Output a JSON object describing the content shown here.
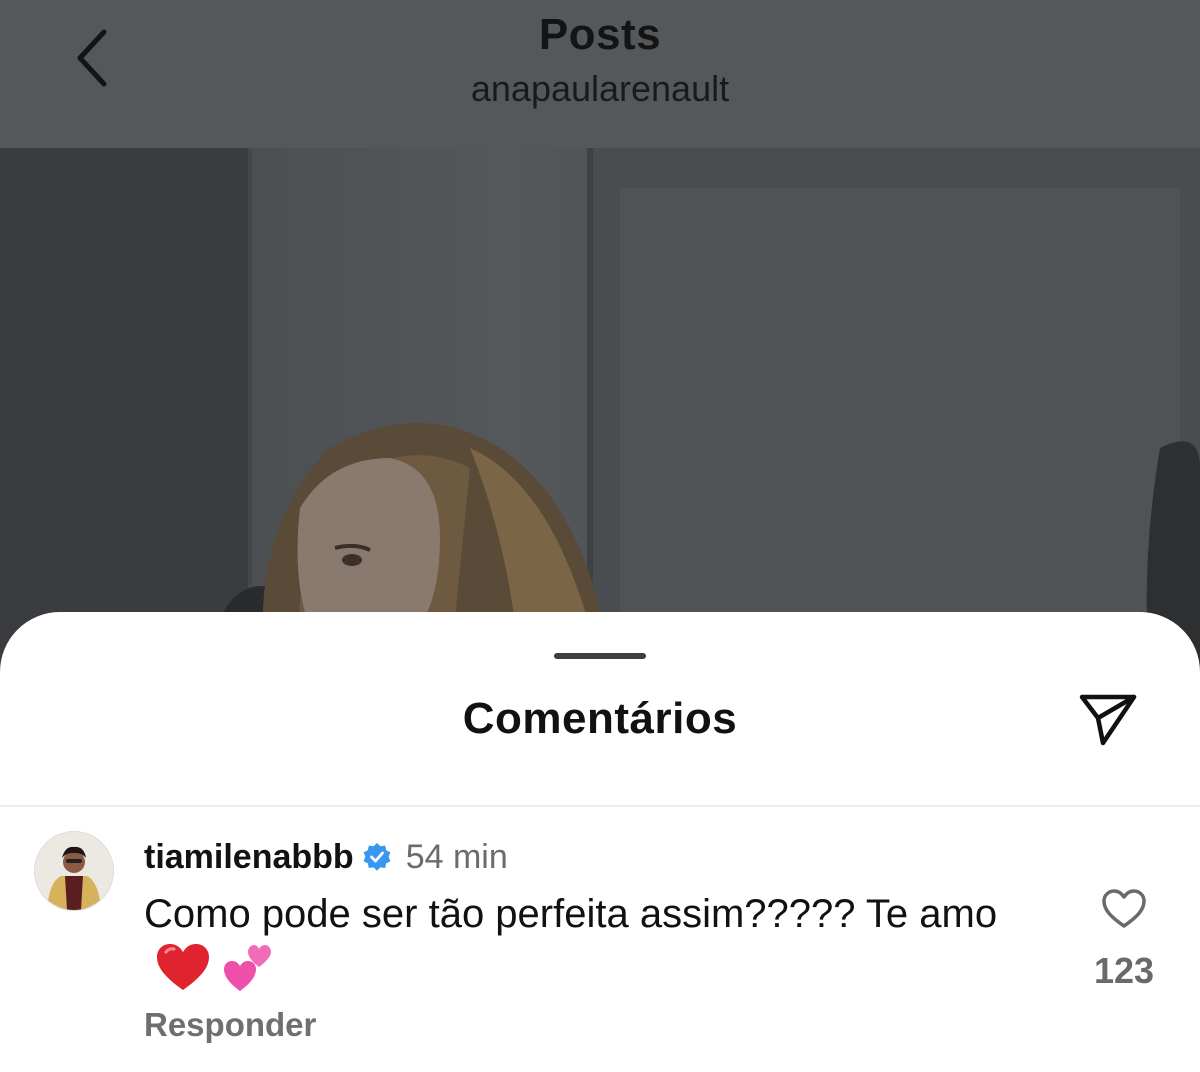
{
  "header": {
    "title": "Posts",
    "subtitle": "anapaularenault",
    "back_icon": "chevron-left-icon"
  },
  "post": {
    "image_description_icon": "photo"
  },
  "comments_sheet": {
    "title": "Comentários",
    "share_icon": "paper-plane-icon"
  },
  "comment": {
    "username": "tiamilenabbb",
    "verified": true,
    "time": "54 min",
    "text": "Como pode ser tão perfeita assim????? Te amo",
    "emojis": [
      "red-heart",
      "two-hearts"
    ],
    "reply_label": "Responder",
    "like_count": "123",
    "like_icon": "heart-outline-icon"
  },
  "colors": {
    "verified_badge": "#3897f0",
    "secondary_text": "#6b6b6b",
    "dim_overlay": "#55585b",
    "heart_red": "#e0242f",
    "heart_pink": "#ee4fa8"
  }
}
